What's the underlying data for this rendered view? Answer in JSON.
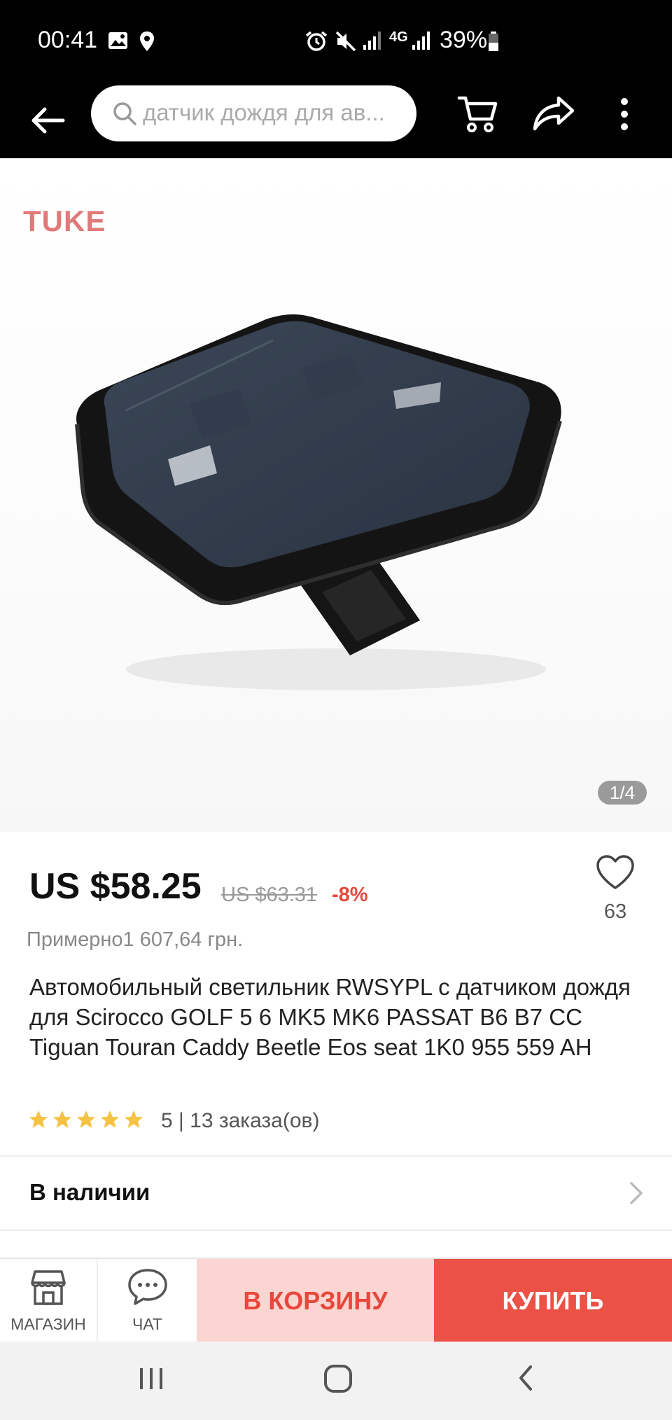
{
  "status_bar": {
    "time": "00:41",
    "network": "4G",
    "battery": "39%"
  },
  "search": {
    "placeholder": "датчик дождя для ав..."
  },
  "gallery": {
    "brand_watermark": "TUKE",
    "counter": "1/4"
  },
  "product": {
    "price": "US $58.25",
    "old_price": "US $63.31",
    "discount": "-8%",
    "wishlist_count": "63",
    "approx_local_price": "Примерно1 607,64 грн.",
    "title": "Автомобильный светильник RWSYPL с датчиком дождя для Scirocco GOLF 5 6 MK5 MK6 PASSAT B6 B7 CC Tiguan Touran Caddy Beetle Eos seat 1K0 955 559 AH",
    "rating_stars": 5,
    "rating_summary": "5 | 13 заказа(ов)"
  },
  "availability": {
    "label": "В наличии"
  },
  "action_bar": {
    "store_label": "МАГАЗИН",
    "chat_label": "ЧАТ",
    "add_to_cart_label": "В КОРЗИНУ",
    "buy_label": "КУПИТЬ"
  },
  "colors": {
    "accent": "#ec5145",
    "cart_bg": "#fbd5d1",
    "star": "#f6c244"
  }
}
